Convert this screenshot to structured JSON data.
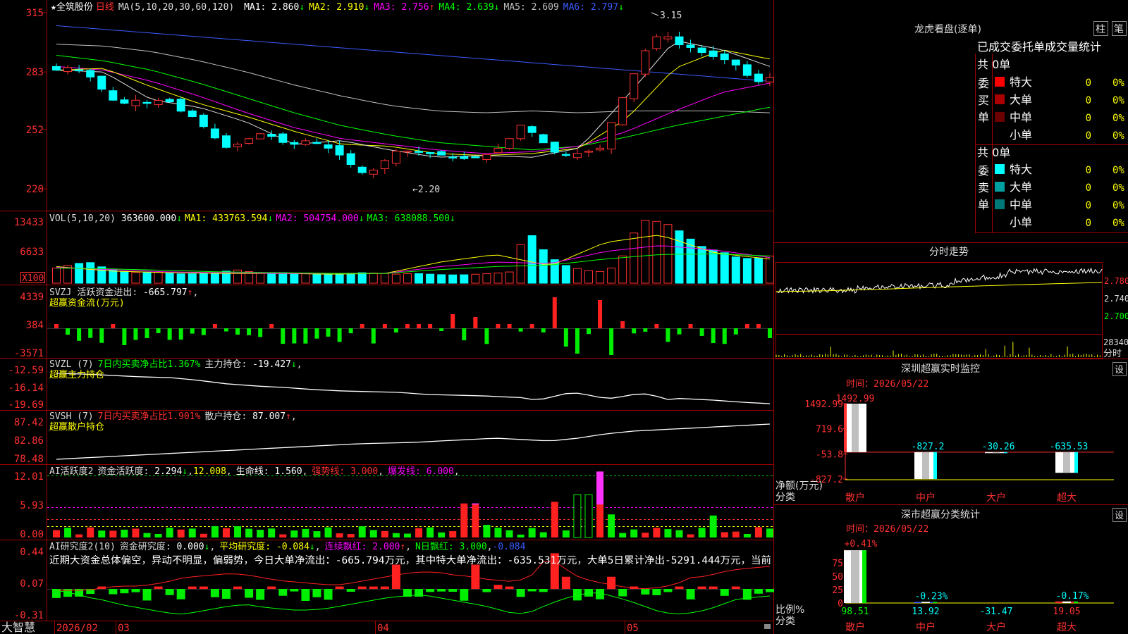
{
  "main": {
    "star": "★",
    "stock_name": "全筑股份",
    "period": "日线",
    "ma_label": "MA(5,10,20,30,60,120)",
    "ma_values": [
      {
        "name": "MA1",
        "value": "2.860",
        "arrow": "↓",
        "color": "#ffffff"
      },
      {
        "name": "MA2",
        "value": "2.910",
        "arrow": "↓",
        "color": "#ffff00"
      },
      {
        "name": "MA3",
        "value": "2.756",
        "arrow": "↑",
        "color": "#ff00ff"
      },
      {
        "name": "MA4",
        "value": "2.639",
        "arrow": "↓",
        "color": "#00ff00"
      },
      {
        "name": "MA5",
        "value": "2.609",
        "arrow": "",
        "color": "#c0c0c0"
      },
      {
        "name": "MA6",
        "value": "2.797",
        "arrow": "↓",
        "color": "#3a5bff"
      }
    ],
    "y_ticks": [
      "315",
      "283",
      "252",
      "220"
    ],
    "y_tick_values": [
      3.15,
      2.83,
      2.52,
      2.2
    ],
    "high_label": "3.15",
    "low_label": "←2.20"
  },
  "vol": {
    "label": "VOL(5,10,20)",
    "value": "363600.000",
    "value_arrow": "↓",
    "ma1_label": "MA1",
    "ma1": "433763.594",
    "ma1_arrow": "↓",
    "ma2_label": "MA2",
    "ma2": "504754.000",
    "ma2_arrow": "↓",
    "ma3_label": "MA3",
    "ma3": "638088.500",
    "ma3_arrow": "↓",
    "y_ticks": [
      "13433",
      "6633"
    ],
    "unit": "X100"
  },
  "svzj": {
    "label": "SVZJ",
    "desc": "活跃资金进出",
    "value": "-665.797",
    "value_arrow": "↑",
    "sub": "超赢资金流(万元)",
    "y_ticks": [
      "4339",
      "384",
      "-3571"
    ]
  },
  "svzl": {
    "label": "SVZL (7)",
    "ratio_text": "7日内买卖净占比1.367%",
    "holding_label": "主力持仓",
    "holding": "-19.427",
    "holding_arrow": "↓",
    "sub": "超赢主力持仓",
    "y_ticks": [
      "-12.59",
      "-16.14",
      "-19.69"
    ]
  },
  "svsh": {
    "label": "SVSH (7)",
    "ratio_text": "7日内买卖净占比1.901%",
    "holding_label": "散户持仓",
    "holding": "87.007",
    "holding_arrow": "↑",
    "sub": "超赢散户持仓",
    "y_ticks": [
      "87.42",
      "82.86",
      "78.48"
    ]
  },
  "ai_active": {
    "label": "AI活跃度2",
    "desc": "资金活跃度",
    "value": "2.294",
    "value_arrow": "↓",
    "v2": "12.008",
    "life_label": "生命线",
    "life": "1.560",
    "strong_label": "强势线",
    "strong": "3.000",
    "burst_label": "爆发线",
    "burst": "6.000",
    "y_ticks": [
      "12.01",
      "5.93",
      "0.00"
    ]
  },
  "ai_research": {
    "label": "AI研究度2(10)",
    "desc": "资金研究度",
    "value": "0.000",
    "value_arrow": "↓",
    "avg_label": "平均研究度",
    "avg": "-0.084",
    "avg_arrow": "↓",
    "cont_label": "连续飘红",
    "cont": "2.000",
    "cont_arrow": "↑",
    "nday_label": "N日飘红",
    "nday": "3.000",
    "last": "-0.084",
    "summary": "近期大资金总体偏空，异动不明显，偏弱势，今日大单净流出：-665.794万元，其中特大单净流出：-635.531万元，大单5日累计净出-5291.444万元，当前",
    "y_ticks": [
      "0.44",
      "0.07",
      "-0.31"
    ]
  },
  "bottom": {
    "brand": "大智慧",
    "dates": [
      "2026/02",
      "03",
      "04",
      "05"
    ]
  },
  "lhb": {
    "title": "龙虎看盘(逐单)",
    "btn_bar": "柱",
    "btn_pen": "笔",
    "header": "已成交委托单成交量统计",
    "buy": {
      "side": "委买单",
      "total": "共 0单",
      "rows": [
        {
          "label": "特大",
          "count": "0",
          "pct": "0%",
          "color": "#ff0000"
        },
        {
          "label": "大单",
          "count": "0",
          "pct": "0%",
          "color": "#aa0000"
        },
        {
          "label": "中单",
          "count": "0",
          "pct": "0%",
          "color": "#6a0000"
        },
        {
          "label": "小单",
          "count": "0",
          "pct": "0%",
          "color": "#000000"
        }
      ]
    },
    "sell": {
      "side": "委卖单",
      "total": "共 0单",
      "rows": [
        {
          "label": "特大",
          "count": "0",
          "pct": "0%",
          "color": "#00ffff"
        },
        {
          "label": "大单",
          "count": "0",
          "pct": "0%",
          "color": "#00a0a0"
        },
        {
          "label": "中单",
          "count": "0",
          "pct": "0%",
          "color": "#007878"
        },
        {
          "label": "小单",
          "count": "0",
          "pct": "0%",
          "color": "#000000"
        }
      ]
    }
  },
  "intraday": {
    "title": "分时走势",
    "y_ticks": [
      "2.780",
      "2.740",
      "2.700"
    ],
    "vol_label": "28340",
    "bottom_label": "分时"
  },
  "monitor": {
    "title": "深圳超赢实时监控",
    "settings": "设",
    "time_label": "时间：",
    "time": "2026/05/22",
    "axis_label": "净额(万元)",
    "cat_label": "分类",
    "y_ticks": [
      "1492.99",
      "719.6",
      "-53.8",
      "-827.2"
    ],
    "categories": [
      "散户",
      "中户",
      "大户",
      "超大"
    ],
    "values": [
      "1492.99",
      "-827.2",
      "-30.26",
      "-635.53"
    ],
    "value_nums": [
      1492.99,
      -827.2,
      -30.26,
      -635.53
    ]
  },
  "classify": {
    "title": "深市超赢分类统计",
    "settings": "设",
    "time_label": "时间：",
    "time": "2026/05/22",
    "axis_label": "比例%",
    "cat_label": "分类",
    "y_ticks": [
      "75",
      "50",
      "25",
      "0"
    ],
    "categories": [
      "散户",
      "中户",
      "大户",
      "超大"
    ],
    "top_values": [
      "+0.41%",
      "-0.23%",
      "",
      "-0.17%"
    ],
    "bottom_values": [
      "98.51",
      "13.92",
      "-31.47",
      "19.05"
    ],
    "value_nums": [
      98.51,
      13.92,
      -31.47,
      19.05
    ]
  }
}
